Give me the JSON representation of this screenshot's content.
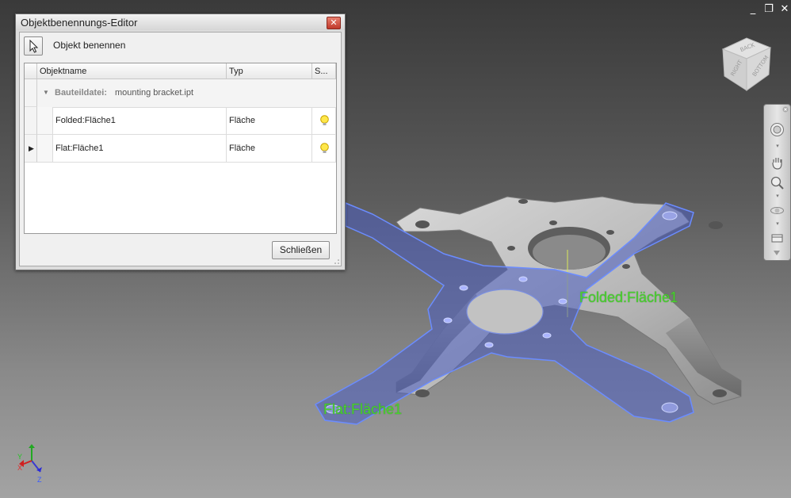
{
  "window_controls": {
    "minimize": "_",
    "restore": "❐",
    "close": "✕"
  },
  "dialog": {
    "title": "Objektbenennungs-Editor",
    "close_icon": "close-icon",
    "pick_button_icon": "cursor-arrow-icon",
    "pick_label": "Objekt benennen",
    "columns": [
      "Objektname",
      "Typ",
      "S..."
    ],
    "group": {
      "label": "Bauteildatei:",
      "value": "mounting bracket.ipt"
    },
    "rows": [
      {
        "name": "Folded:Fläche1",
        "type": "Fläche",
        "status_icon": "lightbulb-icon"
      },
      {
        "name": "Flat:Fläche1",
        "type": "Fläche",
        "status_icon": "lightbulb-icon"
      }
    ],
    "close_button": "Schließen"
  },
  "viewport": {
    "label_folded": {
      "prefix": "Folded:",
      "suffix": "Fläche1"
    },
    "label_flat": {
      "prefix": "Flat:",
      "suffix": "Fläche1"
    },
    "viewcube": {
      "faces": [
        "BACK",
        "RIGHT",
        "BOTTOM"
      ]
    },
    "axes": {
      "x": "X",
      "y": "Y",
      "z": "Z"
    },
    "highlight_color": "#4a78ff",
    "label_color": "#4ad12f"
  },
  "navbar": {
    "icons": [
      "steering-wheel-icon",
      "pan-hand-icon",
      "zoom-icon",
      "orbit-icon",
      "look-at-icon",
      "customize-icon"
    ]
  }
}
